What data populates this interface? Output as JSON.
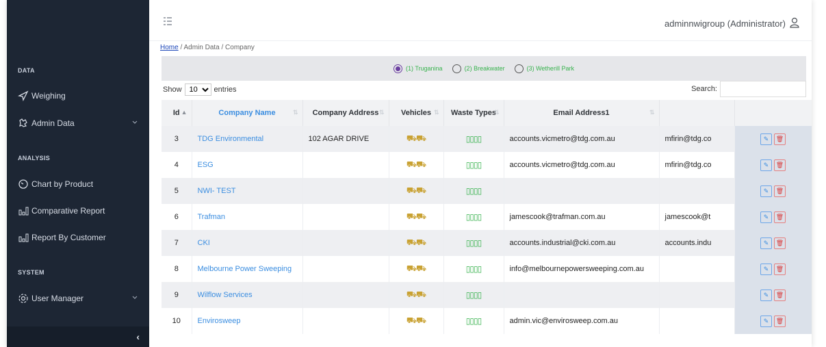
{
  "sidebar": {
    "sections": [
      {
        "title": "DATA"
      },
      {
        "title": "ANALYSIS"
      },
      {
        "title": "SYSTEM"
      }
    ],
    "items": [
      {
        "label": "Weighing",
        "icon": "send-icon"
      },
      {
        "label": "Admin Data",
        "icon": "settings-icon"
      },
      {
        "label": "Chart by Product",
        "icon": "gauge-icon"
      },
      {
        "label": "Comparative Report",
        "icon": "bar-chart-icon"
      },
      {
        "label": "Report By Customer",
        "icon": "bar-chart-icon"
      },
      {
        "label": "User Manager",
        "icon": "gear-icon"
      }
    ],
    "collapse_glyph": "‹"
  },
  "header": {
    "user": "adminnwigroup (Administrator)"
  },
  "breadcrumb": {
    "home": "Home",
    "rest": " / Admin Data / Company"
  },
  "filters": [
    {
      "label": "(1) Truganina",
      "selected": true
    },
    {
      "label": "(2) Breakwater",
      "selected": false
    },
    {
      "label": "(3) Wetherill Park",
      "selected": false
    }
  ],
  "table_controls": {
    "show": "Show",
    "entries_value": "10",
    "entries": "entries",
    "search_label": "Search:"
  },
  "columns": [
    "Id",
    "Company Name",
    "Company Address",
    "Vehicles",
    "Waste Types",
    "Email Address1",
    ""
  ],
  "rows": [
    {
      "id": "3",
      "name": "TDG Environmental",
      "address": "102 AGAR DRIVE",
      "email1": "accounts.vicmetro@tdg.com.au",
      "email2": "mfirin@tdg.co"
    },
    {
      "id": "4",
      "name": "ESG",
      "address": "",
      "email1": "accounts.vicmetro@tdg.com.au",
      "email2": "mfirin@tdg.co"
    },
    {
      "id": "5",
      "name": "NWI- TEST",
      "address": "",
      "email1": "",
      "email2": ""
    },
    {
      "id": "6",
      "name": "Trafman",
      "address": "",
      "email1": "jamescook@trafman.com.au",
      "email2": "jamescook@t"
    },
    {
      "id": "7",
      "name": "CKI",
      "address": "",
      "email1": "accounts.industrial@cki.com.au",
      "email2": "accounts.indu"
    },
    {
      "id": "8",
      "name": "Melbourne Power Sweeping",
      "address": "",
      "email1": "info@melbournepowersweeping.com.au",
      "email2": ""
    },
    {
      "id": "9",
      "name": "Wilflow Services",
      "address": "",
      "email1": "",
      "email2": ""
    },
    {
      "id": "10",
      "name": "Envirosweep",
      "address": "",
      "email1": "admin.vic@envirosweep.com.au",
      "email2": ""
    }
  ],
  "icons": {
    "vehicles": "⛟⛟",
    "waste": "▯▯▯▯",
    "edit": "✎",
    "delete": "🗑"
  },
  "colors": {
    "sidebar_bg": "#1d2634",
    "link_blue": "#3a8de0",
    "radio_green": "#37b24d",
    "vehicle_yellow": "#c9a233"
  }
}
